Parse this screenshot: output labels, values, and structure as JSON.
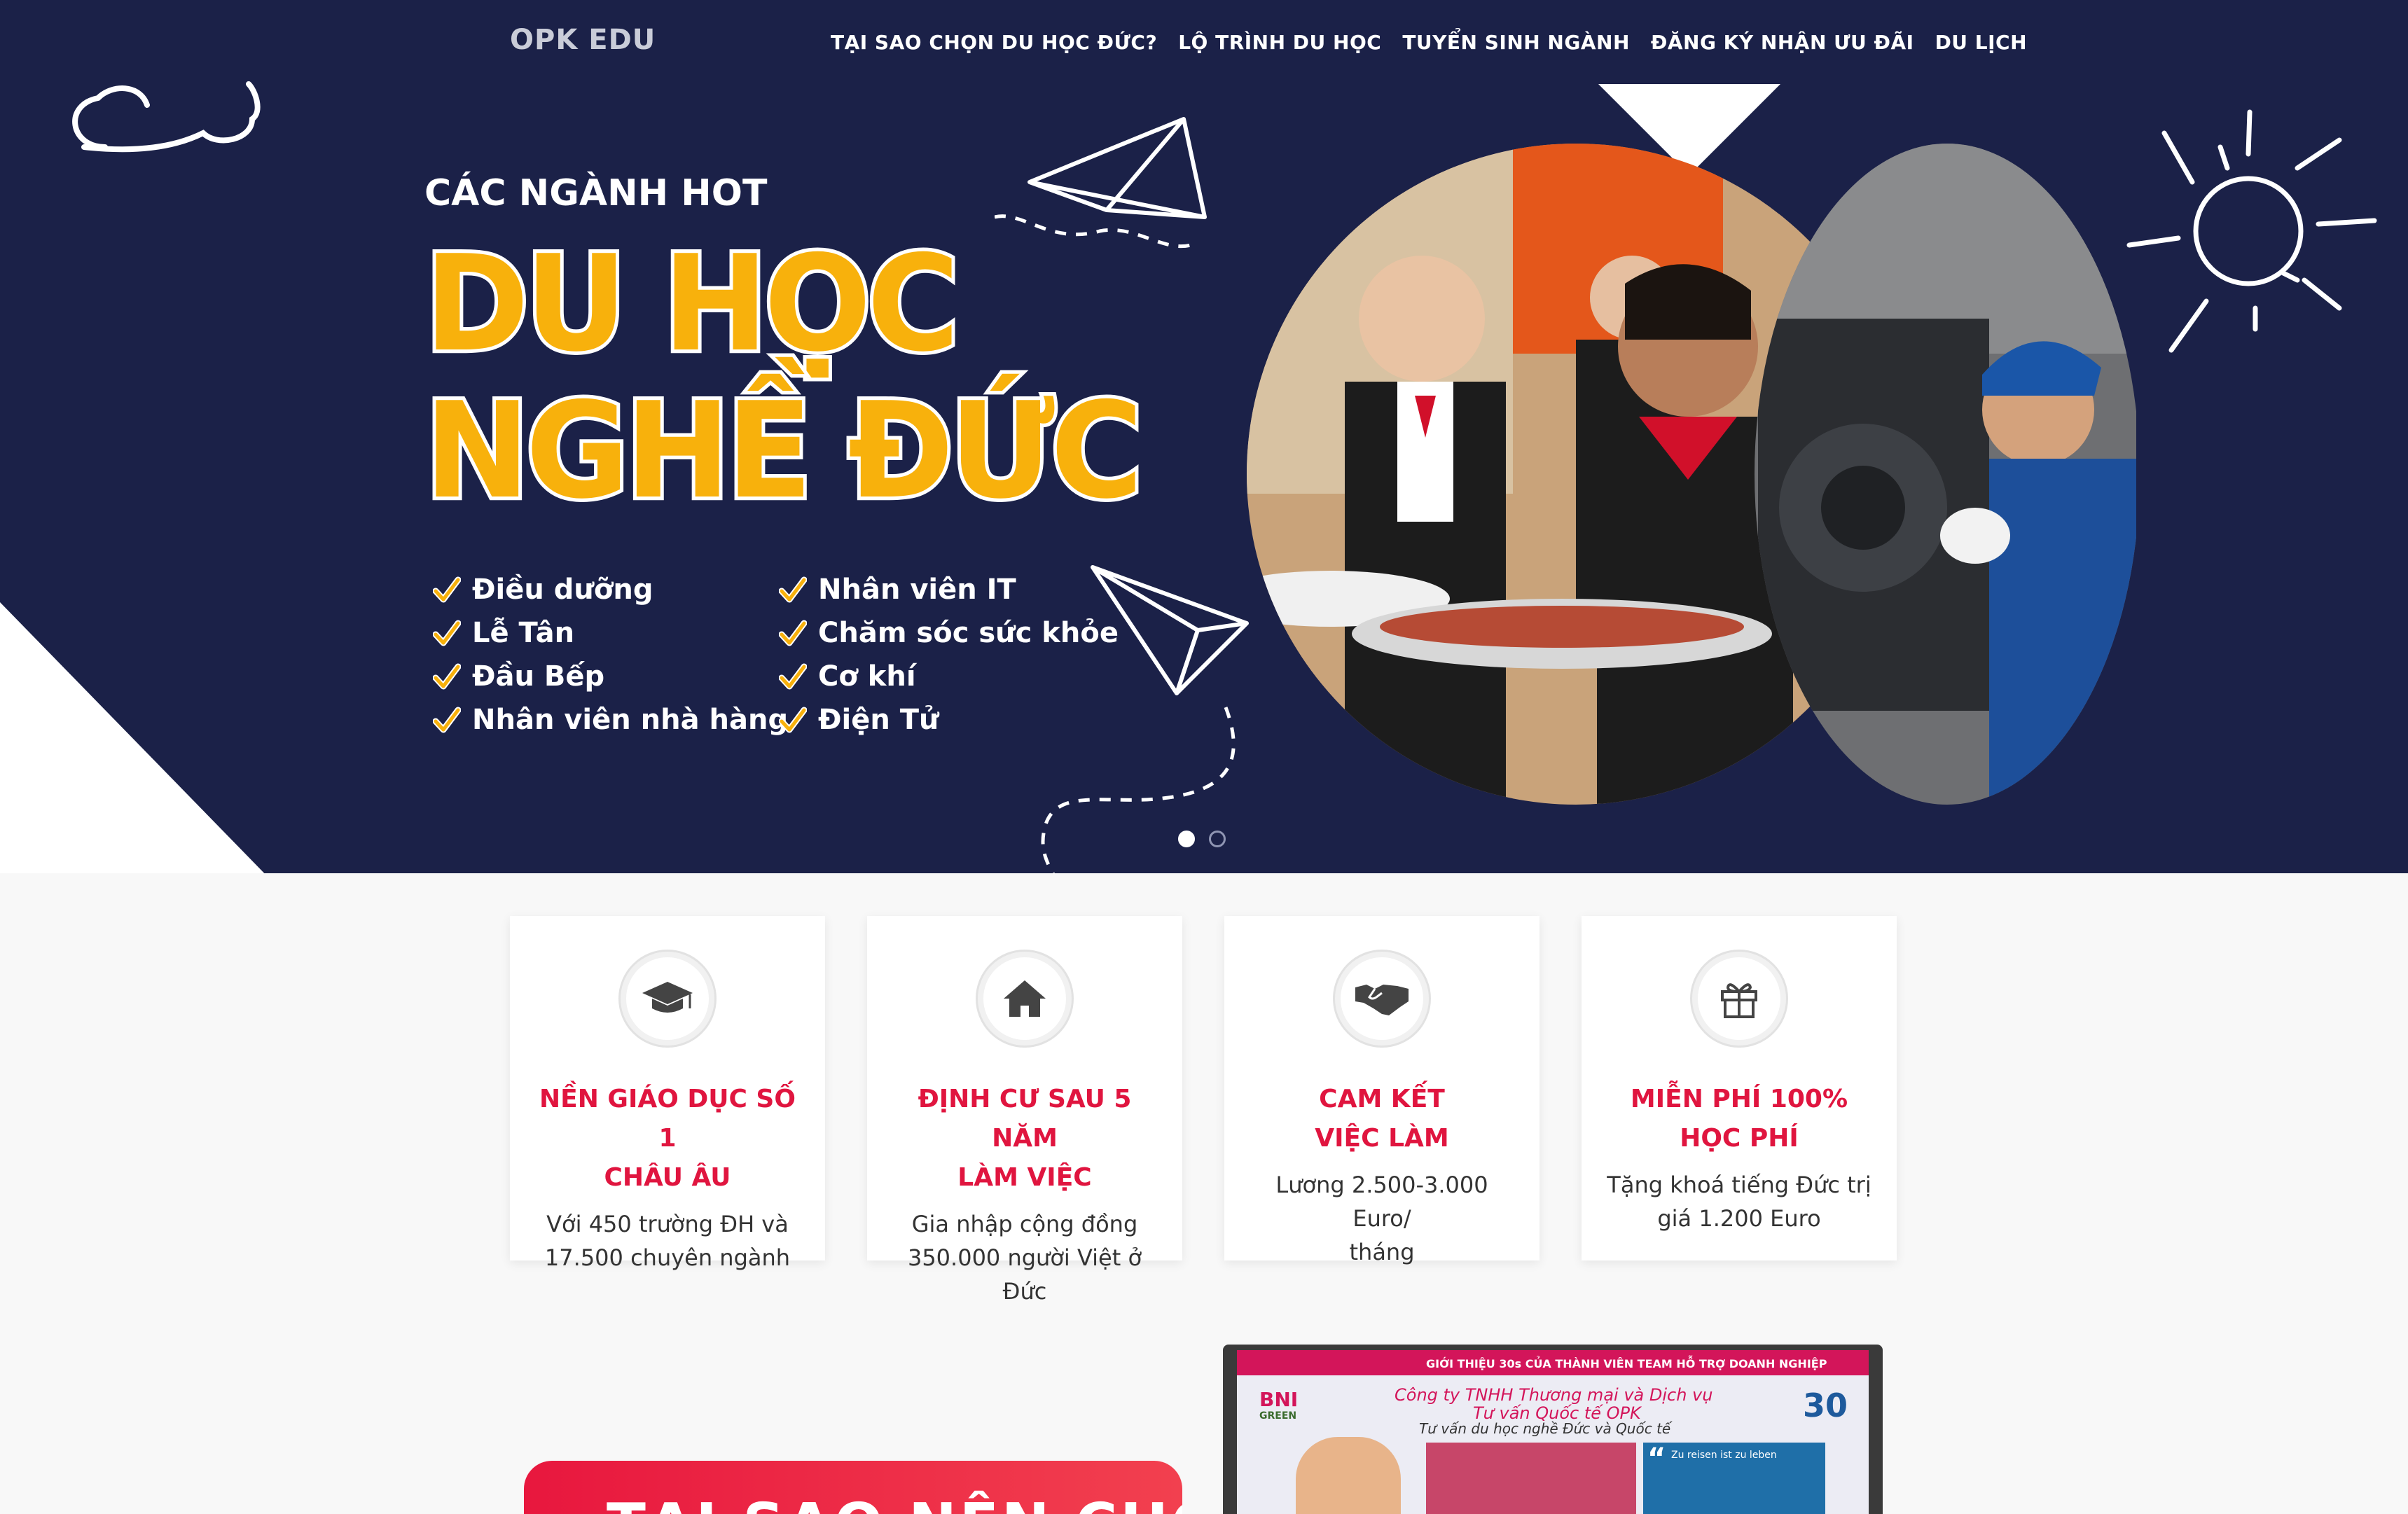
{
  "nav": {
    "brand": "OPK EDU",
    "items": [
      {
        "label": "TẠI SAO CHỌN DU HỌC ĐỨC?"
      },
      {
        "label": "LỘ TRÌNH DU HỌC"
      },
      {
        "label": "TUYỂN SINH NGÀNH"
      },
      {
        "label": "ĐĂNG KÝ NHẬN ƯU ĐÃI"
      },
      {
        "label": "DU LỊCH"
      }
    ]
  },
  "hero": {
    "subtitle": "CÁC NGÀNH HOT",
    "title_line1": "DU HỌC",
    "title_line2": "NGHỀ ĐỨC",
    "majors_left": [
      "Điều dưỡng",
      "Lễ Tân",
      "Đầu Bếp",
      "Nhân viên nhà hàng"
    ],
    "majors_right": [
      "Nhân viên IT",
      "Chăm sóc sức khỏe",
      "Cơ khí",
      "Điện Tử"
    ],
    "check_color": "#f8b10c",
    "slider": {
      "count": 2,
      "active": 1
    }
  },
  "features": [
    {
      "icon": "graduation-cap-icon",
      "title_line1": "NỀN GIÁO DỤC SỐ 1",
      "title_line2": "CHÂU ÂU",
      "text_line1": "Với 450 trường ĐH và",
      "text_line2": "17.500 chuyên ngành"
    },
    {
      "icon": "home-icon",
      "title_line1": "ĐỊNH CƯ SAU 5 NĂM",
      "title_line2": "LÀM VIỆC",
      "text_line1": "Gia nhập cộng đồng",
      "text_line2": "350.000 người Việt ở Đức"
    },
    {
      "icon": "handshake-icon",
      "title_line1": "CAM KẾT",
      "title_line2": "VIỆC LÀM",
      "text_line1": "Lương 2.500-3.000 Euro/",
      "text_line2": "tháng"
    },
    {
      "icon": "gift-icon",
      "title_line1": "MIỄN PHÍ 100%",
      "title_line2": "HỌC PHÍ",
      "text_line1": "Tặng khoá tiếng Đức trị",
      "text_line2": "giá 1.200 Euro"
    }
  ],
  "cta": {
    "label": "TẠI SAO NÊN CHỌN"
  },
  "video": {
    "bni": "BNI",
    "bni_sub": "GREEN",
    "bar_text": "GIỚI THIỆU 30s CỦA THÀNH VIÊN TEAM HỖ TRỢ DOANH NGHIỆP",
    "line1": "Công ty TNHH Thương mại và Dịch vụ",
    "line2": "Tư vấn Quốc tế OPK",
    "line3": "Tư vấn du học nghề Đức và Quốc tế",
    "timer": "30",
    "quote_text": "Zu reisen ist zu leben"
  },
  "colors": {
    "hero_bg": "#1b2148",
    "accent_red": "#e0153f",
    "title_yellow": "#f8b10c"
  }
}
